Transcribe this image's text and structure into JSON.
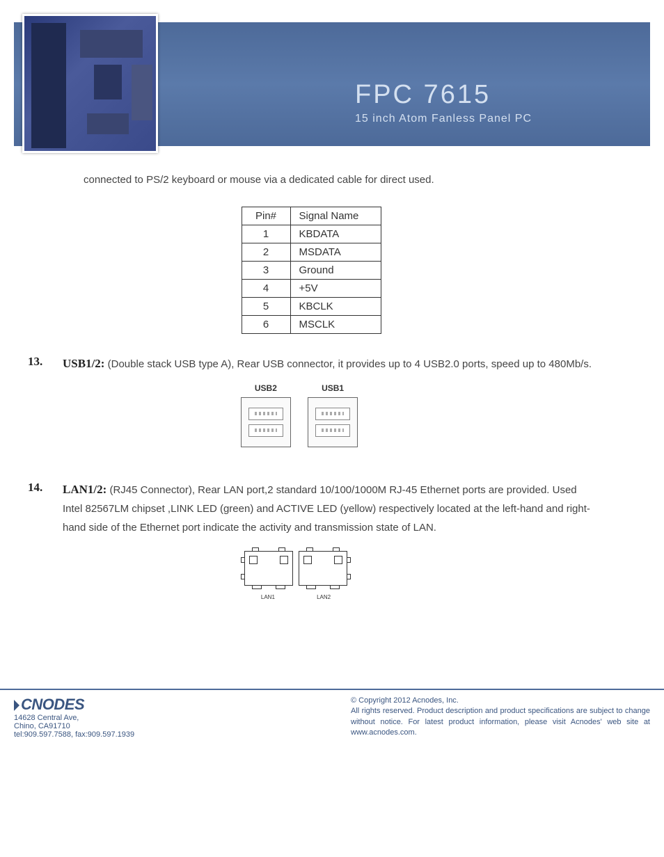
{
  "header": {
    "model": "FPC 7615",
    "subtitle": "15 inch Atom Fanless Panel PC"
  },
  "intro": "connected to PS/2 keyboard or mouse via a dedicated cable for direct used.",
  "pinTable": {
    "headers": [
      "Pin#",
      "Signal Name"
    ],
    "rows": [
      [
        "1",
        "KBDATA"
      ],
      [
        "2",
        "MSDATA"
      ],
      [
        "3",
        "Ground"
      ],
      [
        "4",
        "+5V"
      ],
      [
        "5",
        "KBCLK"
      ],
      [
        "6",
        "MSCLK"
      ]
    ]
  },
  "items": [
    {
      "num": "13.",
      "label": "USB1/2:",
      "text": "(Double stack USB type A), Rear USB connector, it provides up to 4 USB2.0 ports, speed up to 480Mb/s."
    },
    {
      "num": "14.",
      "label": "LAN1/2:",
      "text": "(RJ45 Connector), Rear LAN port,2 standard 10/100/1000M RJ-45 Ethernet ports are provided. Used Intel 82567LM chipset ,LINK LED (green) and ACTIVE LED (yellow) respectively located at the left-hand and right-hand side of the Ethernet port indicate the activity and transmission state of LAN."
    }
  ],
  "usb": {
    "labels": [
      "USB2",
      "USB1"
    ]
  },
  "lan": {
    "labels": [
      "LAN1",
      "LAN2"
    ]
  },
  "footer": {
    "logo": "CNODES",
    "addr1": "14628 Central Ave,",
    "addr2": "Chino, CA91710",
    "tel": "tel:909.597.7588, fax:909.597.1939",
    "copyright": "© Copyright 2012 Acnodes, Inc.",
    "notice": "All rights reserved. Product description and product specifications are subject to change without notice. For latest product information, please visit Acnodes' web site at www.acnodes.com."
  }
}
